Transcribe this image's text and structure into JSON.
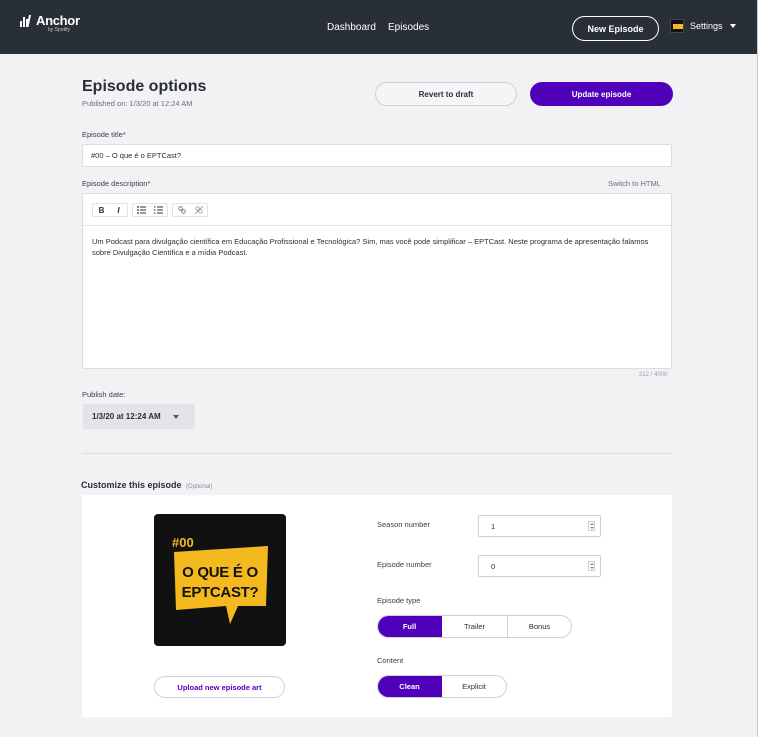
{
  "nav": {
    "logo_text": "Anchor",
    "logo_sub": "by Spotify",
    "links": [
      "Dashboard",
      "Episodes"
    ],
    "new_episode_label": "New Episode",
    "settings_label": "Settings"
  },
  "header": {
    "title": "Episode options",
    "published": "Published on: 1/3/20 at 12:24 AM",
    "revert_label": "Revert to draft",
    "update_label": "Update episode"
  },
  "form": {
    "title_label": "Episode title*",
    "title_value": "#00 – O que é o EPTCast?",
    "description_label": "Episode description*",
    "switch_html_label": "Switch to HTML",
    "description_text": "Um Podcast para divulgação científica em Educação Profissional e Tecnológica? Sim, mas você pode simplificar – EPTCast. Neste programa de apresentação falamos sobre Divulgação Científica e a mídia Podcast.",
    "char_count": "212 / 4000",
    "toolbar": {
      "bold": "B",
      "italic": "I"
    },
    "publish_date_label": "Publish date:",
    "publish_date_value": "1/3/20 at 12:24 AM"
  },
  "customize": {
    "heading": "Customize this episode",
    "optional": "(Optional)",
    "art": {
      "number": "#00",
      "line1": "O QUE É O",
      "line2": "EPTCAST?"
    },
    "upload_label": "Upload new episode art",
    "season_label": "Season number",
    "season_value": "1",
    "episode_number_label": "Episode number",
    "episode_number_value": "0",
    "episode_type_label": "Episode type",
    "episode_types": [
      "Full",
      "Trailer",
      "Bonus"
    ],
    "content_label": "Content",
    "content_options": [
      "Clean",
      "Explicit"
    ]
  },
  "colors": {
    "nav_bg": "#292f36",
    "accent": "#5000b9",
    "art_yellow": "#f3b91f"
  }
}
